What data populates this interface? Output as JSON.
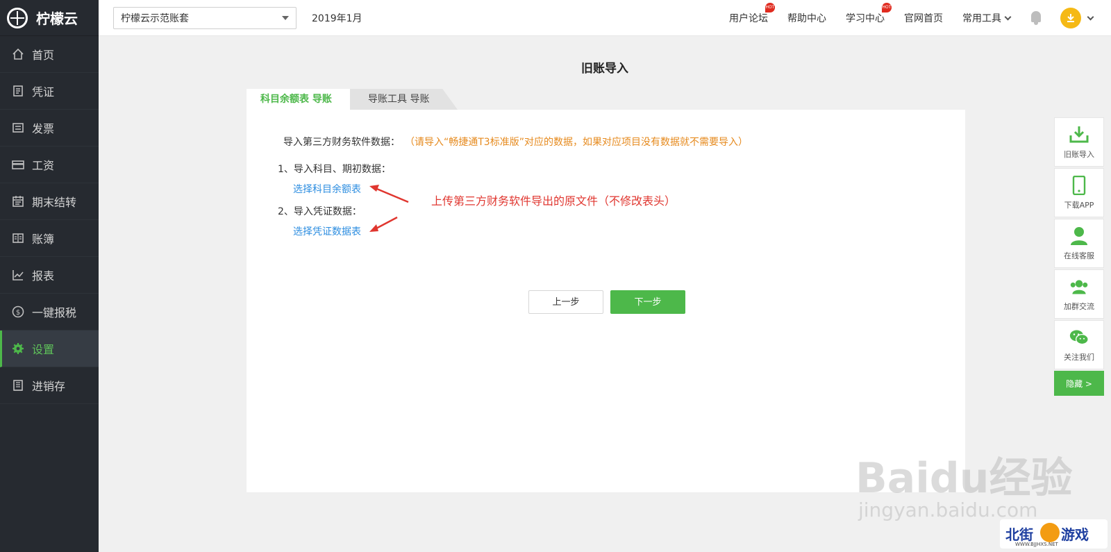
{
  "app": {
    "name": "柠檬云"
  },
  "sidebar": {
    "items": [
      {
        "label": "首页",
        "icon": "home-icon"
      },
      {
        "label": "凭证",
        "icon": "voucher-icon"
      },
      {
        "label": "发票",
        "icon": "invoice-icon"
      },
      {
        "label": "工资",
        "icon": "salary-icon"
      },
      {
        "label": "期末结转",
        "icon": "period-close-icon"
      },
      {
        "label": "账簿",
        "icon": "ledger-icon"
      },
      {
        "label": "报表",
        "icon": "report-icon"
      },
      {
        "label": "一键报税",
        "icon": "tax-icon"
      },
      {
        "label": "设置",
        "icon": "settings-icon",
        "active": true
      },
      {
        "label": "进销存",
        "icon": "inventory-icon"
      }
    ]
  },
  "header": {
    "account_book": "柠檬云示范账套",
    "period": "2019年1月",
    "links": [
      "用户论坛",
      "帮助中心",
      "学习中心",
      "官网首页"
    ],
    "tools": "常用工具",
    "hot_badge": "HOT"
  },
  "main": {
    "title": "旧账导入",
    "tabs": [
      "科目余额表 导账",
      "导账工具 导账"
    ],
    "intro": "导入第三方财务软件数据：",
    "note": "（请导入“畅捷通T3标准版”对应的数据，如果对应项目没有数据就不需要导入）",
    "step1": "1、导入科目、期初数据：",
    "link1": "选择科目余额表",
    "step2": "2、导入凭证数据：",
    "link2": "选择凭证数据表",
    "annotation": "上传第三方财务软件导出的原文件（不修改表头）",
    "prev_button": "上一步",
    "next_button": "下一步"
  },
  "float_toolbar": {
    "items": [
      "旧账导入",
      "下载APP",
      "在线客服",
      "加群交流",
      "关注我们"
    ],
    "hide": "隐藏 >"
  },
  "watermark": {
    "baidu": "Baidu经验",
    "url": "jingyan.baidu.com",
    "site_left": "北街",
    "site_right": "游戏",
    "site_url": "WWW.BJJHXS.NET"
  },
  "colors": {
    "accent": "#4db84a",
    "link": "#2c8de0",
    "warning": "#e68a1e",
    "annotation": "#e0362f",
    "sidebar_bg": "#262a30"
  }
}
